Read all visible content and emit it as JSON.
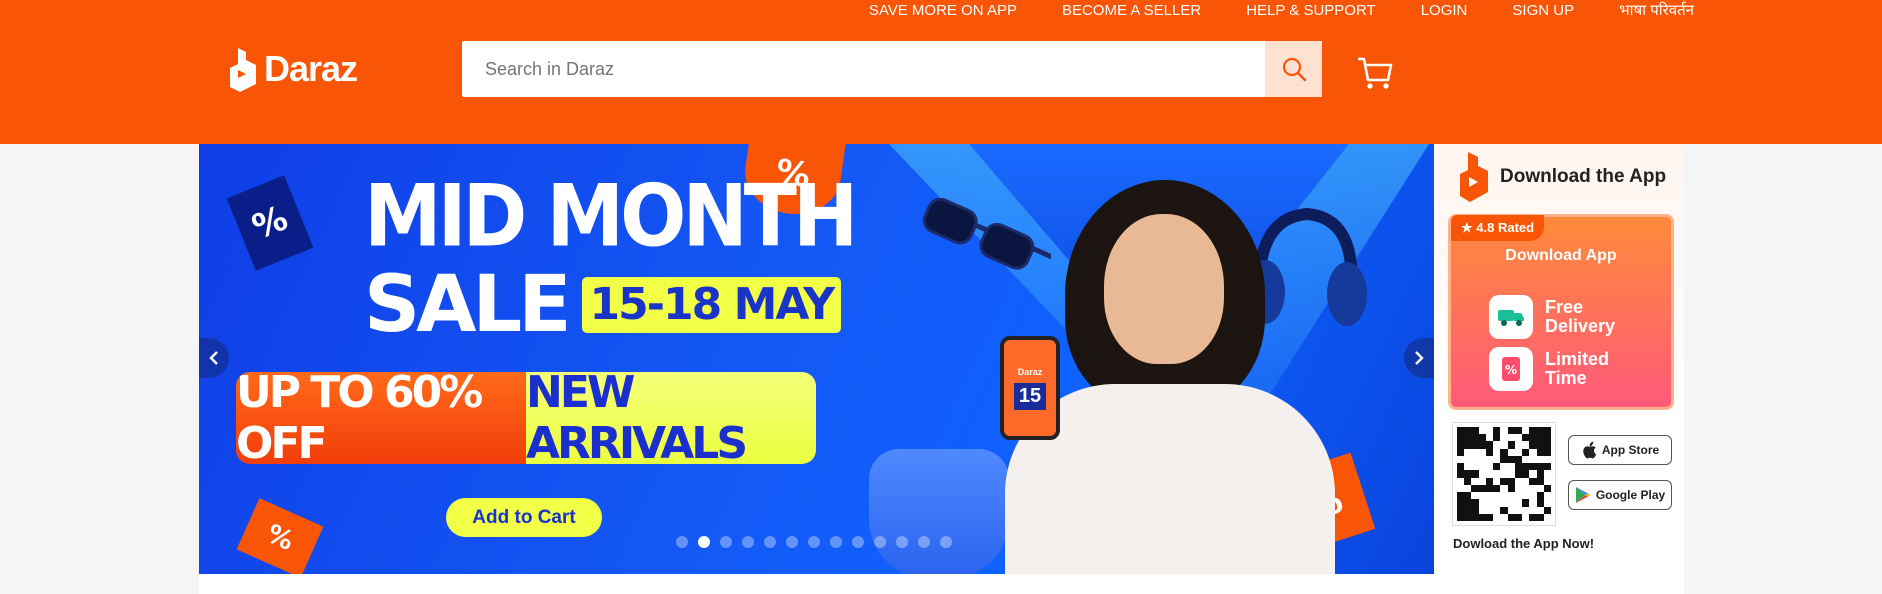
{
  "header": {
    "top_links": [
      "SAVE MORE ON APP",
      "BECOME A SELLER",
      "HELP & SUPPORT",
      "LOGIN",
      "SIGN UP",
      "भाषा परिवर्तन"
    ],
    "logo_text": "Daraz",
    "search_placeholder": "Search in Daraz",
    "search_icon": "search-icon",
    "cart_icon": "cart-icon"
  },
  "colors": {
    "brand": "#f85606",
    "banner_blue": "#1458f5",
    "accent_yellow": "#f1ff46"
  },
  "banner": {
    "headline_line1": "MID MONTH",
    "headline_line2": "SALE",
    "date": "15-18 MAY",
    "offer_left": "UP TO 60% OFF",
    "offer_right": "NEW ARRIVALS",
    "cta": "Add to Cart",
    "tag_symbol": "%",
    "phone_brand": "Daraz",
    "phone_number": "15",
    "slide_count": 13,
    "active_slide": 2
  },
  "side_panel": {
    "title": "Download the App",
    "rated": "4.8 Rated",
    "card_title": "Download App",
    "features": [
      "Free Delivery",
      "Limited Time"
    ],
    "app_store": "App Store",
    "google_play": "Google Play",
    "footer": "Dowload the App Now!"
  }
}
